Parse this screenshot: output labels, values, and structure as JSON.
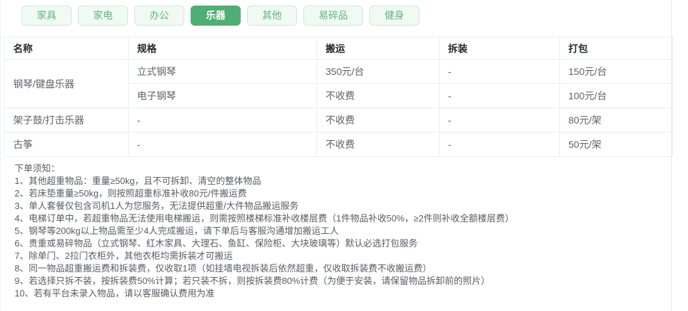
{
  "tabs": [
    {
      "label": "家具",
      "active": false
    },
    {
      "label": "家电",
      "active": false
    },
    {
      "label": "办公",
      "active": false
    },
    {
      "label": "乐器",
      "active": true
    },
    {
      "label": "其他",
      "active": false
    },
    {
      "label": "易碎品",
      "active": false
    },
    {
      "label": "健身",
      "active": false
    }
  ],
  "table": {
    "headers": [
      "名称",
      "规格",
      "搬运",
      "拆装",
      "打包"
    ],
    "rows": [
      {
        "name": "钢琴/键盘乐器",
        "spec": "立式钢琴",
        "move": "350元/台",
        "disassemble": "-",
        "pack": "150元/台"
      },
      {
        "spec": "电子钢琴",
        "move": "不收费",
        "disassemble": "-",
        "pack": "100元/台"
      },
      {
        "name": "架子鼓/打击乐器",
        "spec": "-",
        "move": "不收费",
        "disassemble": "-",
        "pack": "80元/架"
      },
      {
        "name": "古筝",
        "spec": "-",
        "move": "不收费",
        "disassemble": "-",
        "pack": "50元/架"
      }
    ]
  },
  "notes": {
    "title": "下单须知：",
    "items": [
      "1、其他超重物品：重量≥50kg，且不可拆卸、清空的整体物品",
      "2、若床垫重量≥50kg，则按照超重标准补收80元/件搬运费",
      "3、单人套餐仅包含司机1人为您服务，无法提供超重/大件物品搬运服务",
      "4、电梯订单中，若超重物品无法使用电梯搬运，则需按照楼梯标准补收楼层费（1件物品补收50%，≥2件则补收全额楼层费）",
      "5、钢琴等200kg以上物品需至少4人完成搬运，请下单后与客服沟通增加搬运工人",
      "6、贵重或易碎物品（立式钢琴、红木家具、大理石、鱼缸、保险柜、大块玻璃等）默认必选打包服务",
      "7、除单门、2拉门衣柜外，其他衣柜均需拆装才可搬运",
      "8、同一物品超重搬运费和拆装费，仅收取1项（如挂墙电视拆装后依然超重，仅收取拆装费不收搬运费）",
      "9、若选择只拆不装，按拆装费50%计算；若只装不拆，则按拆装费80%计费（为便于安装，请保留物品拆卸前的照片）",
      "10、若有平台未录入物品，请以客服确认费用为准"
    ]
  },
  "colors": {
    "accent_green": "#4fae74",
    "tab_inactive_bg": "#f0f9f2",
    "tab_inactive_border": "#cfe8d8",
    "tab_inactive_text": "#61b57d",
    "table_border": "#e9efec",
    "header_text": "#262a2e",
    "cell_text": "#5c6268",
    "note_text": "#565c63"
  }
}
